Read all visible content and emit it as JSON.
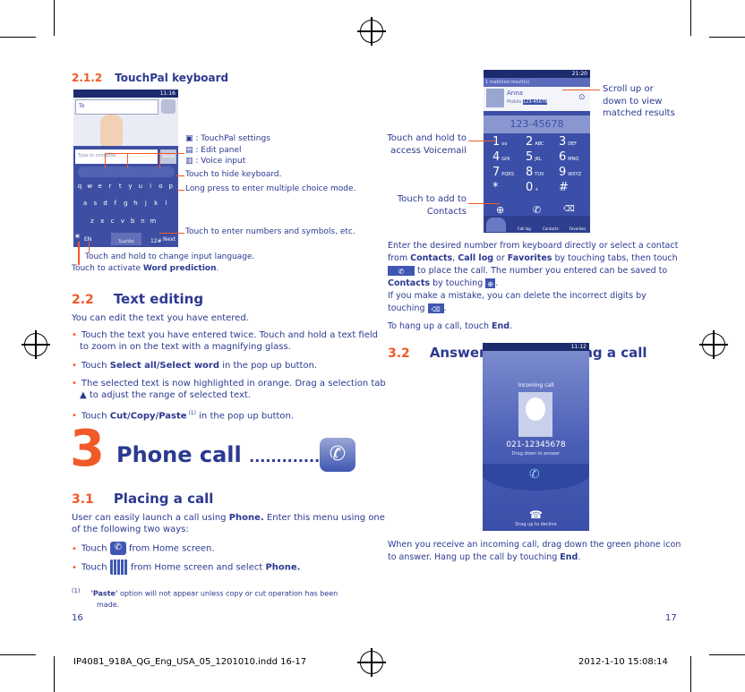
{
  "left": {
    "s212": {
      "num": "2.1.2",
      "title": "TouchPal keyboard"
    },
    "kb_screen": {
      "time": "11:16",
      "to": "To",
      "compose": "Type to compose",
      "counter": "160/1",
      "send": "Send",
      "keys_row1": [
        "q",
        "w",
        "e",
        "r",
        "t",
        "y",
        "u",
        "i",
        "o",
        "p"
      ],
      "keys_row2": [
        "a",
        "s",
        "d",
        "f",
        "g",
        "h",
        "j",
        "k",
        "l"
      ],
      "keys_row3": [
        "z",
        "x",
        "c",
        "v",
        "b",
        "n",
        "m"
      ],
      "lang": "EN",
      "space": "TouchPal",
      "sym": "12#",
      "next": "Next"
    },
    "callouts": {
      "settings": ": TouchPal settings",
      "edit": ": Edit panel",
      "voice": ": Voice input",
      "hide": "Touch to hide keyboard.",
      "long": "Long press to enter multiple choice mode.",
      "numbers": "Touch to enter numbers and symbols, etc.",
      "lang": "Touch and hold to change input language.",
      "predict_pre": "Touch to activate ",
      "predict_bold": "Word prediction",
      "predict_post": "."
    },
    "s22": {
      "num": "2.2",
      "title": "Text editing",
      "intro": "You can edit the text you have entered.",
      "b1a": "Touch the text you have entered twice. Touch and hold a text field",
      "b1b": "to zoom in on the text with a magnifying glass.",
      "b2pre": "Touch ",
      "b2bold": "Select all/Select word",
      "b2post": " in the pop up button.",
      "b3a": "The selected text is now highlighted in orange. Drag a selection tab",
      "b3b": " to adjust the range of selected text.",
      "b4pre": "Touch ",
      "b4bold": "Cut/Copy/Paste",
      "b4sup": " (1)",
      "b4post": " in the pop up button."
    },
    "ch3": {
      "num": "3",
      "title": "Phone call",
      "dots": "...............",
      "icon": "phone-icon"
    },
    "s31": {
      "num": "3.1",
      "title": "Placing a call",
      "p1pre": "User can easily launch a call using ",
      "p1bold": "Phone.",
      "p1post": " Enter this menu using one",
      "p2": "of the following two ways:",
      "b1pre": "Touch ",
      "b1post": " from Home screen.",
      "b2pre": "Touch ",
      "b2post": " from Home screen and select ",
      "b2bold": "Phone."
    },
    "footnote": {
      "mark": "(1)",
      "bold": "'Paste'",
      "text": " option will not appear unless copy or cut operation has been",
      "text2": "made."
    },
    "page": "16"
  },
  "right": {
    "dialer": {
      "time": "21:20",
      "matched": "1 matched result(s)",
      "name": "Anna",
      "sub": "Mobile",
      "num": "123-45678",
      "display": "123-45678",
      "keys": [
        [
          "1",
          "oo"
        ],
        [
          "2",
          "ABC"
        ],
        [
          "3",
          "DEF"
        ],
        [
          "4",
          "GHI"
        ],
        [
          "5",
          "JKL"
        ],
        [
          "6",
          "MNO"
        ],
        [
          "7",
          "PQRS"
        ],
        [
          "8",
          "TUV"
        ],
        [
          "9",
          "WXYZ"
        ],
        [
          "*",
          ""
        ],
        [
          "0",
          "+"
        ],
        [
          "#",
          ""
        ]
      ],
      "tabs": [
        "Call log",
        "Contacts",
        "Favorites"
      ]
    },
    "callouts": {
      "scroll1": "Scroll up or",
      "scroll2": "down to view",
      "scroll3": "matched results",
      "vm1": "Touch and hold to",
      "vm2": "access Voicemail",
      "add1": "Touch to add to",
      "add2": "Contacts"
    },
    "para": {
      "l1": "Enter the desired number from keyboard directly or select a contact",
      "l2pre": "from ",
      "l2b1": "Contacts",
      "l2m1": ", ",
      "l2b2": "Call log",
      "l2m2": " or ",
      "l2b3": "Favorites",
      "l2post": " by touching tabs, then touch",
      "l3": " to  place  the  call.  The  number  you  entered  can  be  saved  to",
      "l4b": "Contacts",
      "l4post": " by touching ",
      "l5": "If you make a mistake, you can delete the incorrect digits by",
      "l6": "touching ",
      "hang_pre": "To hang up a call, touch ",
      "hang_b": "End",
      "hang_post": "."
    },
    "s32": {
      "num": "3.2",
      "title": "Answering or rejecting a call"
    },
    "incoming": {
      "time": "11:12",
      "title": "Incoming call",
      "number": "021-12345678",
      "answer": "Drag down to answer",
      "decline": "Drag up to decline"
    },
    "para2": {
      "l1": "When you receive an incoming call, drag down the green phone icon",
      "l2pre": "to answer. Hang up the call by touching ",
      "l2b": "End",
      "l2post": "."
    },
    "page": "17"
  },
  "slug": {
    "file": "IP4081_918A_QG_Eng_USA_05_1201010.indd   16-17",
    "date": "2012-1-10   15:08:14"
  },
  "colors": {
    "text": "#2b3990",
    "accent": "#f05a28",
    "screen": "#3b4fa8"
  }
}
